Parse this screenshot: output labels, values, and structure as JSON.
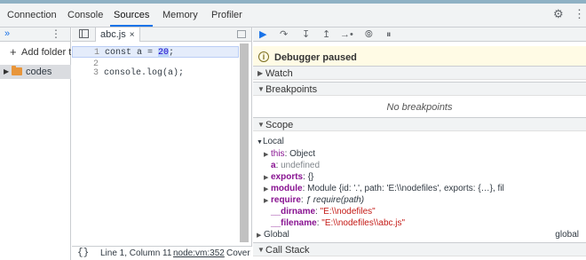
{
  "top_tabs": [
    "Connection",
    "Console",
    "Sources",
    "Memory",
    "Profiler"
  ],
  "active_tab": "Sources",
  "navigator": {
    "add_folder_label": "Add folder to",
    "folder_name": "codes"
  },
  "editor": {
    "file_tab": "abc.js",
    "file_close": "×",
    "lines": [
      {
        "num": "1",
        "pre": "const a = ",
        "sel": "20",
        "post": ";"
      },
      {
        "num": "2",
        "text": ""
      },
      {
        "num": "3",
        "text": "console.log(a);"
      }
    ],
    "status_braces": "{}",
    "status_position": "Line 1, Column 11",
    "status_link": "node:vm:352",
    "status_coverage": "Cover"
  },
  "debugger": {
    "paused_text": "Debugger paused",
    "sections": {
      "watch": "Watch",
      "breakpoints": "Breakpoints",
      "no_breakpoints": "No breakpoints",
      "scope": "Scope",
      "local": "Local",
      "global": "Global",
      "global_value": "global",
      "call_stack": "Call Stack"
    },
    "scope_local": [
      {
        "name": "this",
        "sep": ": ",
        "value": "Object",
        "expandable": true
      },
      {
        "name": "a",
        "sep": ": ",
        "value": "undefined",
        "expandable": false
      },
      {
        "name": "exports",
        "sep": ": ",
        "value": "{}",
        "expandable": true
      },
      {
        "name": "module",
        "sep": ": ",
        "value": "Module {id: '.', path: 'E:\\\\nodefiles', exports: {…}, fil",
        "expandable": true
      },
      {
        "name": "require",
        "sep": ": ",
        "value": "ƒ require(path)",
        "expandable": true
      },
      {
        "name": "__dirname",
        "sep": ": ",
        "value": "\"E:\\\\nodefiles\"",
        "expandable": false
      },
      {
        "name": "__filename",
        "sep": ": ",
        "value": "\"E:\\\\nodefiles\\\\abc.js\"",
        "expandable": false
      }
    ]
  }
}
